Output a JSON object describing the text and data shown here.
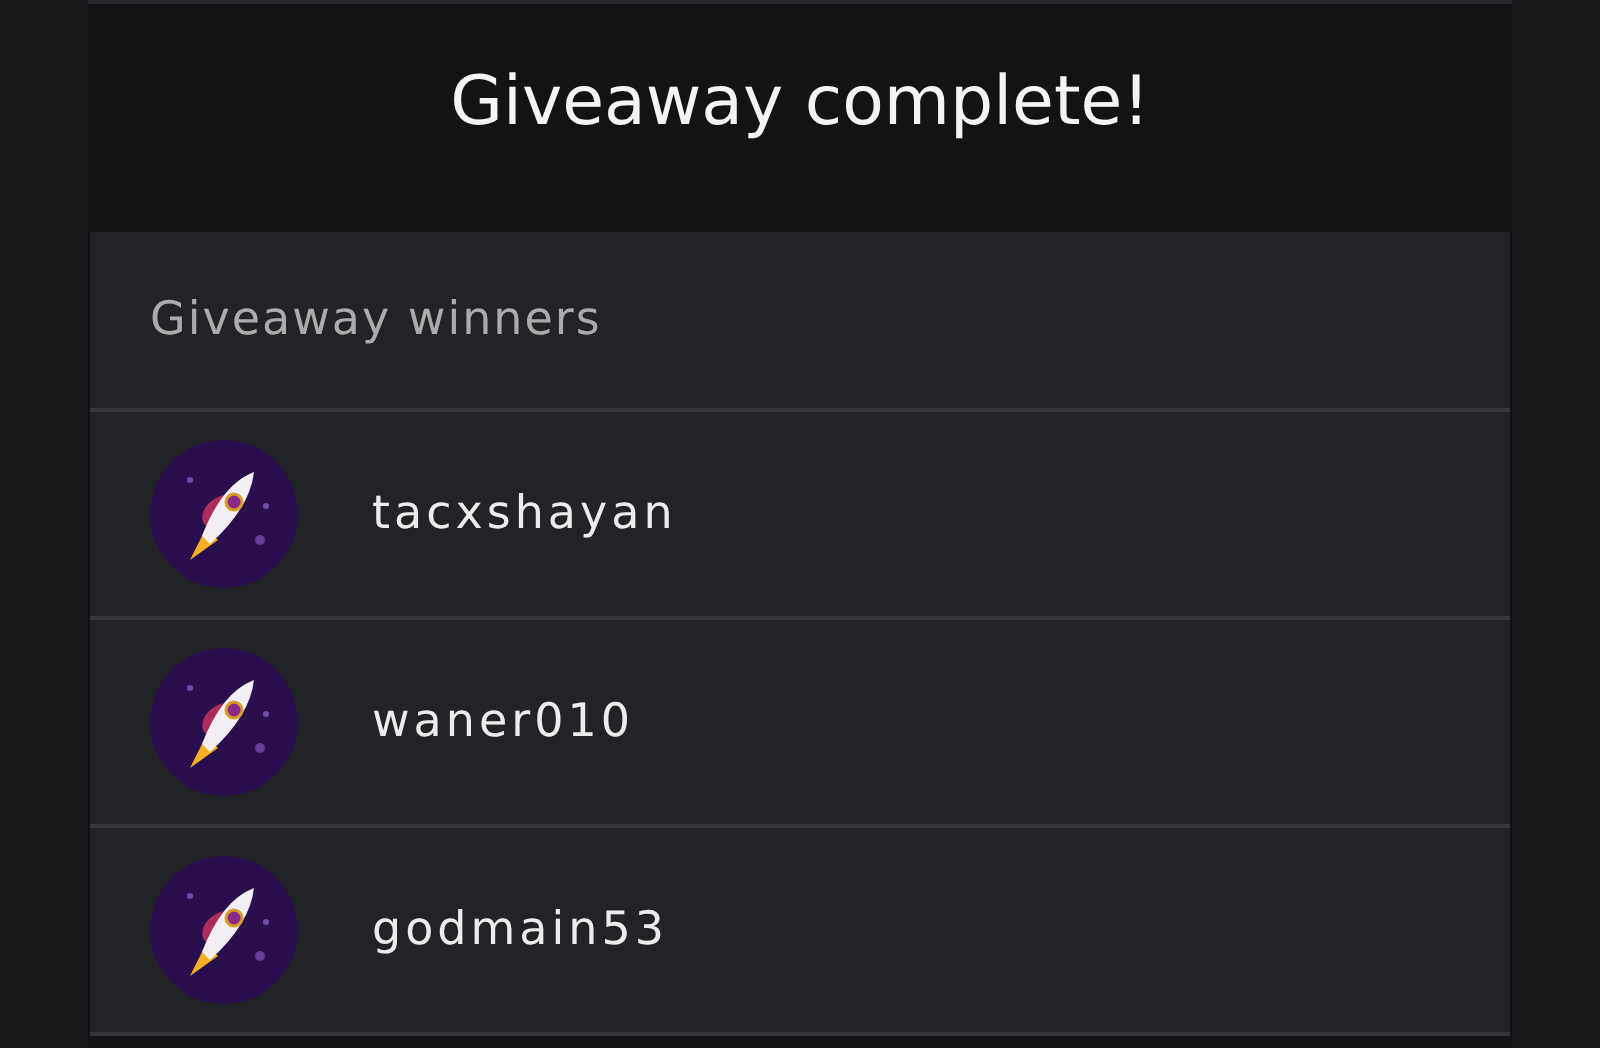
{
  "title": "Giveaway complete!",
  "winners_card": {
    "heading": "Giveaway winners",
    "winners": [
      {
        "name": "tacxshayan"
      },
      {
        "name": "waner010"
      },
      {
        "name": "godmain53"
      }
    ]
  }
}
